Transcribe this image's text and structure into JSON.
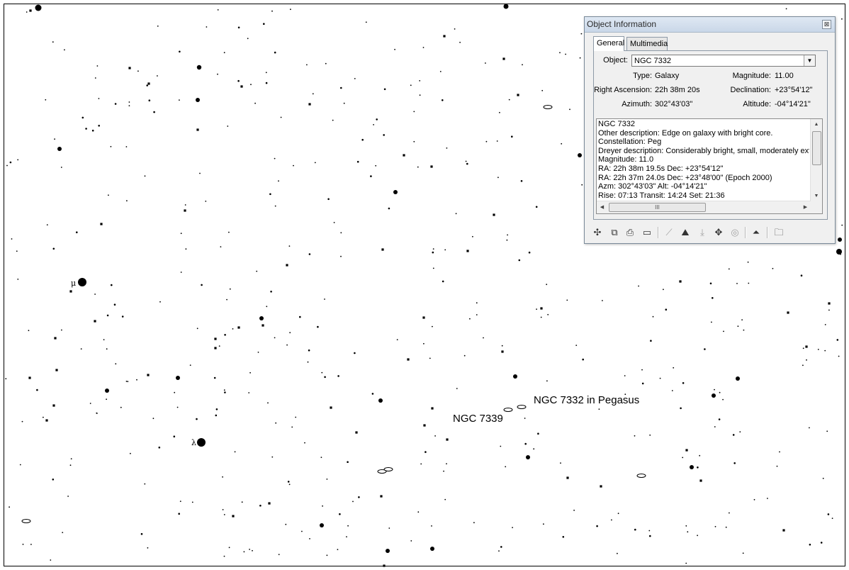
{
  "chart_labels": {
    "target_label": "NGC 7332 in Pegasus",
    "neighbor_label": "NGC 7339",
    "star_mu": "μ",
    "star_lambda": "λ"
  },
  "window": {
    "title": "Object Information",
    "close_glyph": "⊠",
    "tabs": [
      {
        "label": "General",
        "active": true
      },
      {
        "label": "Multimedia",
        "active": false
      }
    ],
    "object_label": "Object:",
    "object_value": "NGC 7332",
    "fields": {
      "type_label": "Type:",
      "type_value": "Galaxy",
      "magnitude_label": "Magnitude:",
      "magnitude_value": "11.00",
      "ra_label": "Right Ascension:",
      "ra_value": "22h 38m 20s",
      "dec_label": "Declination:",
      "dec_value": "+23°54'12\"",
      "azimuth_label": "Azimuth:",
      "azimuth_value": "302°43'03\"",
      "altitude_label": "Altitude:",
      "altitude_value": "-04°14'21\""
    },
    "description_lines": [
      "NGC 7332",
      "Other description: Edge on galaxy with bright core.",
      "Constellation:  Peg",
      "Dreyer description: Considerably bright, small, moderately extended",
      "Magnitude: 11.0",
      "RA: 22h 38m 19.5s  Dec: +23°54'12\"",
      "RA: 22h 37m 24.0s  Dec: +23°48'00\"  (Epoch 2000)",
      "Azm: 302°43'03\"  Alt: -04°14'21\"",
      "Rise: 07:13  Transit: 14:24  Set: 21:36"
    ],
    "hscroll_grip": "III",
    "toolbar_icons": [
      "center-icon",
      "copy-icon",
      "print-icon",
      "book-icon",
      "telescope-icon",
      "image-icon",
      "download-icon",
      "pointer-icon",
      "planet-icon",
      "up-arrow-icon",
      "folder-icon"
    ]
  }
}
